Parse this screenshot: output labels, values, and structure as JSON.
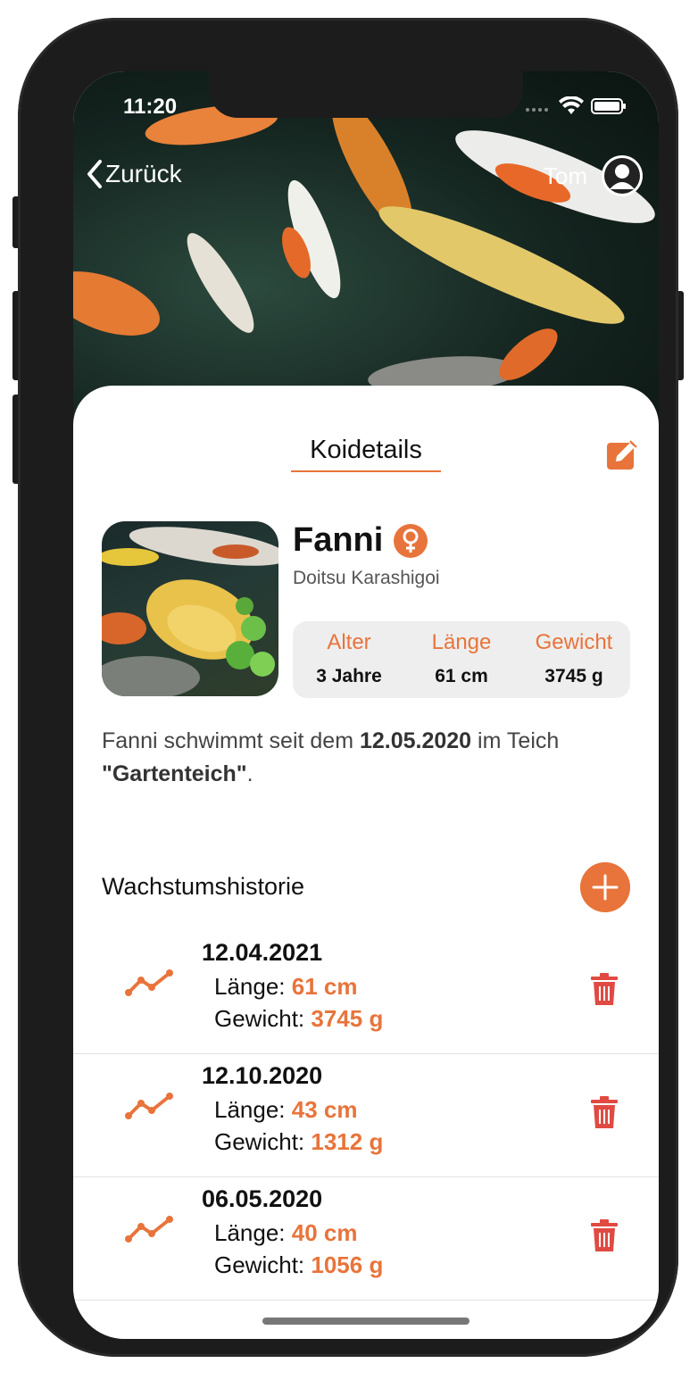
{
  "status_bar": {
    "time": "11:20"
  },
  "nav": {
    "back_label": "Zurück",
    "user_name": "Tom"
  },
  "card": {
    "title": "Koidetails"
  },
  "koi": {
    "name": "Fanni",
    "variety": "Doitsu Karashigoi",
    "stats": [
      {
        "label": "Alter",
        "value": "3 Jahre"
      },
      {
        "label": "Länge",
        "value": "61 cm"
      },
      {
        "label": "Gewicht",
        "value": "3745 g"
      }
    ],
    "description": {
      "prefix": "Fanni schwimmt seit dem ",
      "date": "12.05.2020",
      "middle": " im Teich ",
      "pond_quote_open": "\"",
      "pond": "Gartenteich",
      "pond_quote_close": "\"",
      "suffix": "."
    }
  },
  "history": {
    "title": "Wachstumshistorie",
    "length_label": "Länge: ",
    "weight_label": "Gewicht: ",
    "entries": [
      {
        "date": "12.04.2021",
        "length": "61 cm",
        "weight": "3745 g"
      },
      {
        "date": "12.10.2020",
        "length": "43 cm",
        "weight": "1312 g"
      },
      {
        "date": "06.05.2020",
        "length": "40 cm",
        "weight": "1056 g"
      }
    ]
  },
  "colors": {
    "accent": "#e8743b",
    "delete": "#e04a42"
  }
}
